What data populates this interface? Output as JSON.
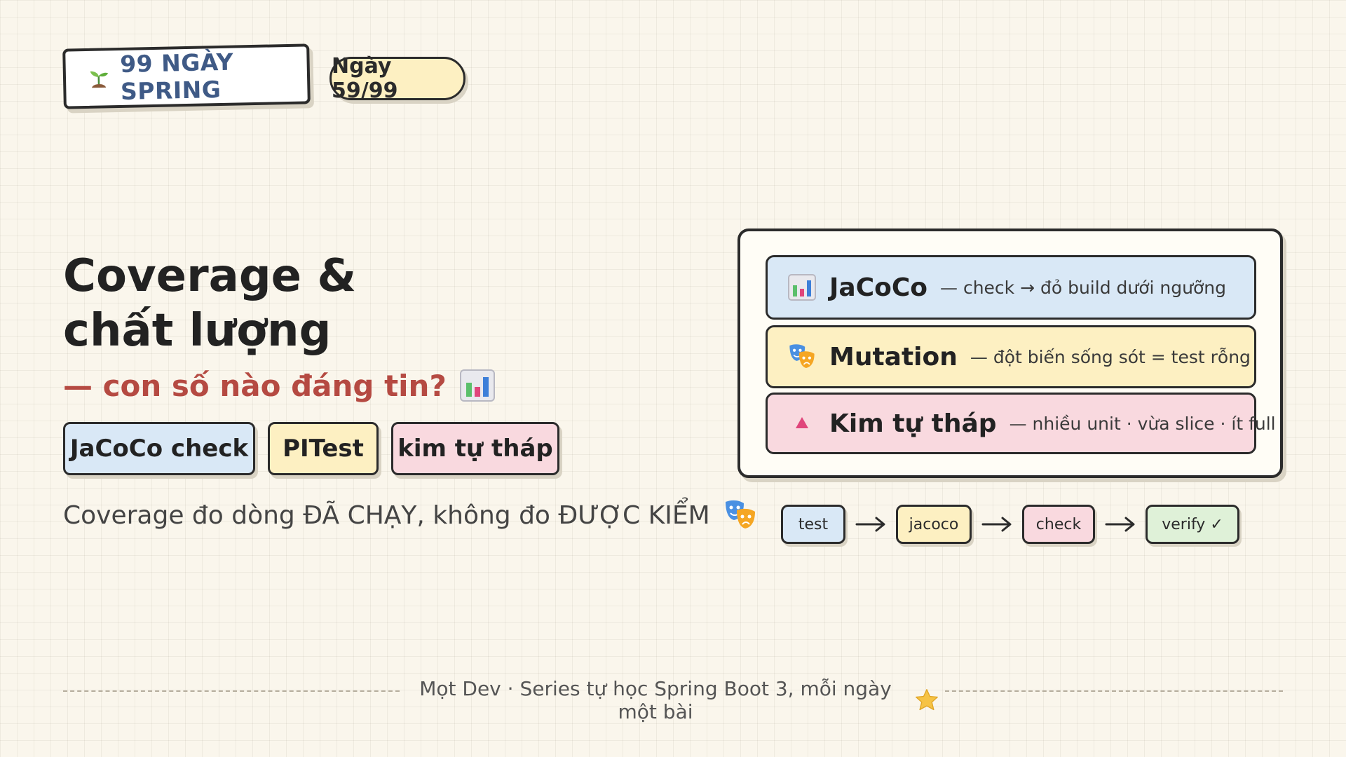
{
  "header": {
    "brand": "99 NGÀY SPRING",
    "day_badge": "Ngày 59/99"
  },
  "title": {
    "line1": "Coverage &",
    "line2": "chất lượng",
    "subtitle": "— con số nào đáng tin?"
  },
  "tags": [
    "JaCoCo check",
    "PITest",
    "kim tự tháp"
  ],
  "note": "Coverage đo dòng ĐÃ CHẠY, không đo ĐƯỢC KIỂM",
  "panel": {
    "rows": [
      {
        "name": "JaCoCo",
        "desc": "— check → đỏ build dưới ngưỡng",
        "icon": "bar-chart-icon"
      },
      {
        "name": "Mutation",
        "desc": "— đột biến sống sót = test rỗng",
        "icon": "theater-masks-icon"
      },
      {
        "name": "Kim tự tháp",
        "desc": "— nhiều unit · vừa slice · ít full",
        "icon": "pink-triangle-icon"
      }
    ]
  },
  "pipeline": [
    "test",
    "jacoco",
    "check",
    "verify ✓"
  ],
  "footer": "Mọt Dev · Series tự học Spring Boot 3, mỗi ngày một bài",
  "colors": {
    "background": "#faf6ec",
    "blue": "#d9e8f6",
    "yellow": "#fdf0c2",
    "pink": "#f9d9df",
    "green": "#dff1d8",
    "accent_red": "#b54a42",
    "brand_blue": "#3f5a86"
  }
}
